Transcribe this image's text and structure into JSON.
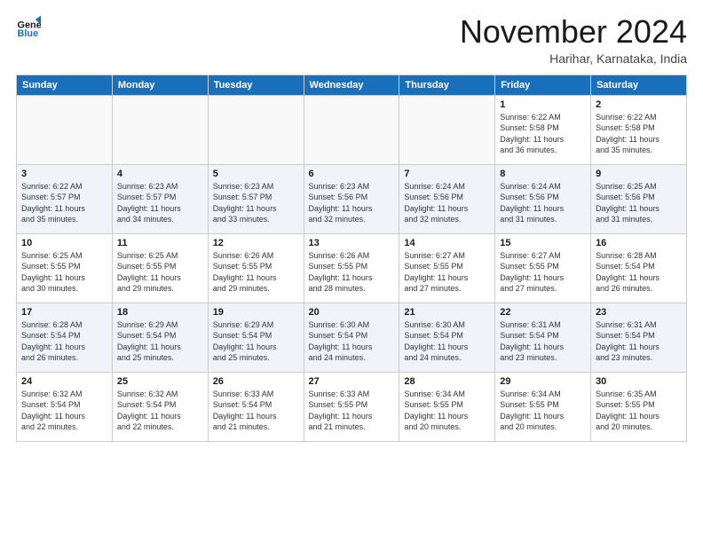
{
  "header": {
    "logo_line1": "General",
    "logo_line2": "Blue",
    "month": "November 2024",
    "location": "Harihar, Karnataka, India"
  },
  "weekdays": [
    "Sunday",
    "Monday",
    "Tuesday",
    "Wednesday",
    "Thursday",
    "Friday",
    "Saturday"
  ],
  "weeks": [
    [
      {
        "day": "",
        "info": ""
      },
      {
        "day": "",
        "info": ""
      },
      {
        "day": "",
        "info": ""
      },
      {
        "day": "",
        "info": ""
      },
      {
        "day": "",
        "info": ""
      },
      {
        "day": "1",
        "info": "Sunrise: 6:22 AM\nSunset: 5:58 PM\nDaylight: 11 hours\nand 36 minutes."
      },
      {
        "day": "2",
        "info": "Sunrise: 6:22 AM\nSunset: 5:58 PM\nDaylight: 11 hours\nand 35 minutes."
      }
    ],
    [
      {
        "day": "3",
        "info": "Sunrise: 6:22 AM\nSunset: 5:57 PM\nDaylight: 11 hours\nand 35 minutes."
      },
      {
        "day": "4",
        "info": "Sunrise: 6:23 AM\nSunset: 5:57 PM\nDaylight: 11 hours\nand 34 minutes."
      },
      {
        "day": "5",
        "info": "Sunrise: 6:23 AM\nSunset: 5:57 PM\nDaylight: 11 hours\nand 33 minutes."
      },
      {
        "day": "6",
        "info": "Sunrise: 6:23 AM\nSunset: 5:56 PM\nDaylight: 11 hours\nand 32 minutes."
      },
      {
        "day": "7",
        "info": "Sunrise: 6:24 AM\nSunset: 5:56 PM\nDaylight: 11 hours\nand 32 minutes."
      },
      {
        "day": "8",
        "info": "Sunrise: 6:24 AM\nSunset: 5:56 PM\nDaylight: 11 hours\nand 31 minutes."
      },
      {
        "day": "9",
        "info": "Sunrise: 6:25 AM\nSunset: 5:56 PM\nDaylight: 11 hours\nand 31 minutes."
      }
    ],
    [
      {
        "day": "10",
        "info": "Sunrise: 6:25 AM\nSunset: 5:55 PM\nDaylight: 11 hours\nand 30 minutes."
      },
      {
        "day": "11",
        "info": "Sunrise: 6:25 AM\nSunset: 5:55 PM\nDaylight: 11 hours\nand 29 minutes."
      },
      {
        "day": "12",
        "info": "Sunrise: 6:26 AM\nSunset: 5:55 PM\nDaylight: 11 hours\nand 29 minutes."
      },
      {
        "day": "13",
        "info": "Sunrise: 6:26 AM\nSunset: 5:55 PM\nDaylight: 11 hours\nand 28 minutes."
      },
      {
        "day": "14",
        "info": "Sunrise: 6:27 AM\nSunset: 5:55 PM\nDaylight: 11 hours\nand 27 minutes."
      },
      {
        "day": "15",
        "info": "Sunrise: 6:27 AM\nSunset: 5:55 PM\nDaylight: 11 hours\nand 27 minutes."
      },
      {
        "day": "16",
        "info": "Sunrise: 6:28 AM\nSunset: 5:54 PM\nDaylight: 11 hours\nand 26 minutes."
      }
    ],
    [
      {
        "day": "17",
        "info": "Sunrise: 6:28 AM\nSunset: 5:54 PM\nDaylight: 11 hours\nand 26 minutes."
      },
      {
        "day": "18",
        "info": "Sunrise: 6:29 AM\nSunset: 5:54 PM\nDaylight: 11 hours\nand 25 minutes."
      },
      {
        "day": "19",
        "info": "Sunrise: 6:29 AM\nSunset: 5:54 PM\nDaylight: 11 hours\nand 25 minutes."
      },
      {
        "day": "20",
        "info": "Sunrise: 6:30 AM\nSunset: 5:54 PM\nDaylight: 11 hours\nand 24 minutes."
      },
      {
        "day": "21",
        "info": "Sunrise: 6:30 AM\nSunset: 5:54 PM\nDaylight: 11 hours\nand 24 minutes."
      },
      {
        "day": "22",
        "info": "Sunrise: 6:31 AM\nSunset: 5:54 PM\nDaylight: 11 hours\nand 23 minutes."
      },
      {
        "day": "23",
        "info": "Sunrise: 6:31 AM\nSunset: 5:54 PM\nDaylight: 11 hours\nand 23 minutes."
      }
    ],
    [
      {
        "day": "24",
        "info": "Sunrise: 6:32 AM\nSunset: 5:54 PM\nDaylight: 11 hours\nand 22 minutes."
      },
      {
        "day": "25",
        "info": "Sunrise: 6:32 AM\nSunset: 5:54 PM\nDaylight: 11 hours\nand 22 minutes."
      },
      {
        "day": "26",
        "info": "Sunrise: 6:33 AM\nSunset: 5:54 PM\nDaylight: 11 hours\nand 21 minutes."
      },
      {
        "day": "27",
        "info": "Sunrise: 6:33 AM\nSunset: 5:55 PM\nDaylight: 11 hours\nand 21 minutes."
      },
      {
        "day": "28",
        "info": "Sunrise: 6:34 AM\nSunset: 5:55 PM\nDaylight: 11 hours\nand 20 minutes."
      },
      {
        "day": "29",
        "info": "Sunrise: 6:34 AM\nSunset: 5:55 PM\nDaylight: 11 hours\nand 20 minutes."
      },
      {
        "day": "30",
        "info": "Sunrise: 6:35 AM\nSunset: 5:55 PM\nDaylight: 11 hours\nand 20 minutes."
      }
    ]
  ]
}
